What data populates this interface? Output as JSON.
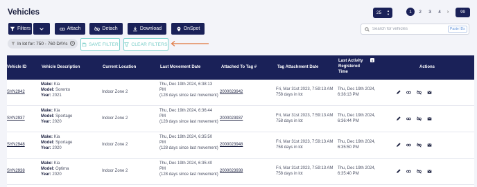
{
  "page": {
    "title": "Vehicles"
  },
  "pagination": {
    "page_size": "25",
    "pages": [
      "1",
      "2",
      "3",
      "4"
    ],
    "active_page": "1",
    "next_icon": "›",
    "total": "99"
  },
  "toolbar": {
    "filters_label": "Filters",
    "attach_label": "Attach",
    "detach_label": "Detach",
    "download_label": "Download",
    "onspot_label": "OnSpot"
  },
  "search": {
    "placeholder": "Search for vehicles",
    "paste_ids_label": "Paste IDs"
  },
  "active_filter": {
    "label": "In lot for: 750 - 760 DAYs",
    "remove_icon": "×"
  },
  "filter_actions": {
    "save_label": "SAVE FILTER",
    "clear_label": "CLEAR FILTERS"
  },
  "colors": {
    "primary": "#1a2158",
    "accent_teal": "#7dd3cf",
    "arrow": "#e0733a",
    "background": "#f3f4f9"
  },
  "table": {
    "headers": {
      "vehicle_id": "Vehicle ID",
      "description": "Vehicle Description",
      "location": "Current Location",
      "last_movement": "Last Movement Date",
      "attached_tag": "Attached To Tag #",
      "tag_attachment": "Tag Attachment Date",
      "last_activity_1": "Last Activity",
      "last_activity_2": "Registered",
      "last_activity_3": "Time",
      "actions": "Actions"
    },
    "labels": {
      "make": "Make:",
      "model": "Model:",
      "year": "Year:"
    },
    "rows": [
      {
        "vehicle_id": "SYN2942",
        "make": "Kia",
        "model": "Sorento",
        "year": "2021",
        "location": "Indoor Zone 2",
        "movement_1": "Thu, Dec 19th 2024, 6:38:13",
        "movement_2": "PM",
        "movement_3": "(128 days since last movement)",
        "tag": "2000023942",
        "tag_date_1": "Fri, Mar 31st 2023, 7:59:13 AM",
        "tag_date_2": "758 days in lot",
        "activity_1": "Thu, Dec 19th 2024,",
        "activity_2": "6:38:13 PM"
      },
      {
        "vehicle_id": "SYN2937",
        "make": "Kia",
        "model": "Sportage",
        "year": "2020",
        "location": "Indoor Zone 2",
        "movement_1": "Thu, Dec 19th 2024, 6:36:44",
        "movement_2": "PM",
        "movement_3": "(128 days since last movement)",
        "tag": "2000023937",
        "tag_date_1": "Fri, Mar 31st 2023, 7:59:13 AM",
        "tag_date_2": "758 days in lot",
        "activity_1": "Thu, Dec 19th 2024,",
        "activity_2": "6:36:44 PM"
      },
      {
        "vehicle_id": "SYN2948",
        "make": "Kia",
        "model": "Sportage",
        "year": "2020",
        "location": "Indoor Zone 2",
        "movement_1": "Thu, Dec 19th 2024, 6:35:50",
        "movement_2": "PM",
        "movement_3": "(128 days since last movement)",
        "tag": "2000023948",
        "tag_date_1": "Fri, Mar 31st 2023, 7:59:13 AM",
        "tag_date_2": "758 days in lot",
        "activity_1": "Thu, Dec 19th 2024,",
        "activity_2": "6:35:50 PM"
      },
      {
        "vehicle_id": "SYN2938",
        "make": "Kia",
        "model": "Optima",
        "year": "2020",
        "location": "Indoor Zone 2",
        "movement_1": "Thu, Dec 19th 2024, 6:35:40",
        "movement_2": "PM",
        "movement_3": "(128 days since last movement)",
        "tag": "2000023938",
        "tag_date_1": "Fri, Mar 31st 2023, 7:59:13 AM",
        "tag_date_2": "758 days in lot",
        "activity_1": "Thu, Dec 19th 2024,",
        "activity_2": "6:35:40 PM"
      }
    ]
  },
  "icons": {
    "actions": [
      "edit-icon",
      "link-icon",
      "unlink-icon",
      "mail-icon"
    ]
  }
}
